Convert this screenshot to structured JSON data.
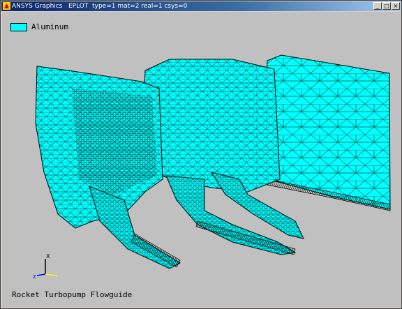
{
  "window": {
    "title": "ANSYS Graphics   EPLOT  type=1 mat=2 real=1 csys=0",
    "buttons": {
      "minimize": "_",
      "maximize": "□",
      "close": "×"
    },
    "icon": "ansys-app-icon"
  },
  "legend": {
    "label": "Aluminum",
    "color": "#00ffff"
  },
  "triad": {
    "x_label": "X",
    "y_label": "Y",
    "z_label": "Z"
  },
  "caption": "Rocket Turbopump Flowguide",
  "colors": {
    "background": "#c0c0c0",
    "mesh_fill": "#00ffff",
    "mesh_edge": "#000000"
  }
}
